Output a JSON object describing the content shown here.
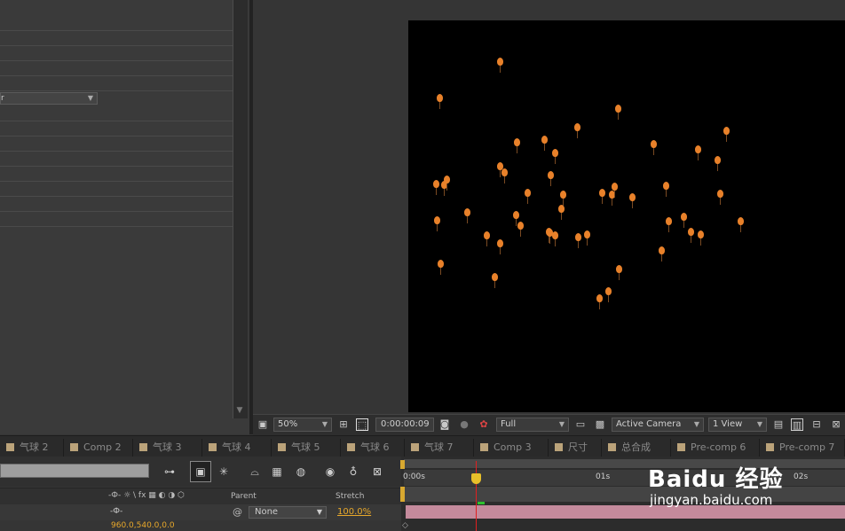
{
  "left_panel": {
    "blend_dropdown_value": "r"
  },
  "viewer_toolbar": {
    "zoom": "50%",
    "timecode": "0:00:00:09",
    "resolution": "Full",
    "camera": "Active Camera",
    "views": "1 View"
  },
  "tabs": [
    {
      "label": "气球 2"
    },
    {
      "label": "Comp 2"
    },
    {
      "label": "气球 3"
    },
    {
      "label": "气球 4"
    },
    {
      "label": "气球 5"
    },
    {
      "label": "气球 6"
    },
    {
      "label": "气球 7"
    },
    {
      "label": "Comp 3"
    },
    {
      "label": "尺寸"
    },
    {
      "label": "总合成"
    },
    {
      "label": "Pre-comp 6"
    },
    {
      "label": "Pre-comp 7"
    }
  ],
  "timeline": {
    "columns": {
      "parent": "Parent",
      "stretch": "Stretch"
    },
    "layer": {
      "parent": "None",
      "stretch": "100.0%",
      "position": "960.0,540.0,0.0"
    },
    "ruler": {
      "start": "0:00s",
      "one_sec": "01s",
      "two_sec": "02s"
    },
    "switch_icons": "-Ф- ☼ \\ fx ▦ ◐ ◑ ⬡"
  },
  "watermark": {
    "logo": "Baidu 经验",
    "url": "jingyan.baidu.com"
  },
  "colors": {
    "balloon": "#e8812a",
    "layer_bar": "#c48a9c",
    "playhead": "#e02020"
  }
}
